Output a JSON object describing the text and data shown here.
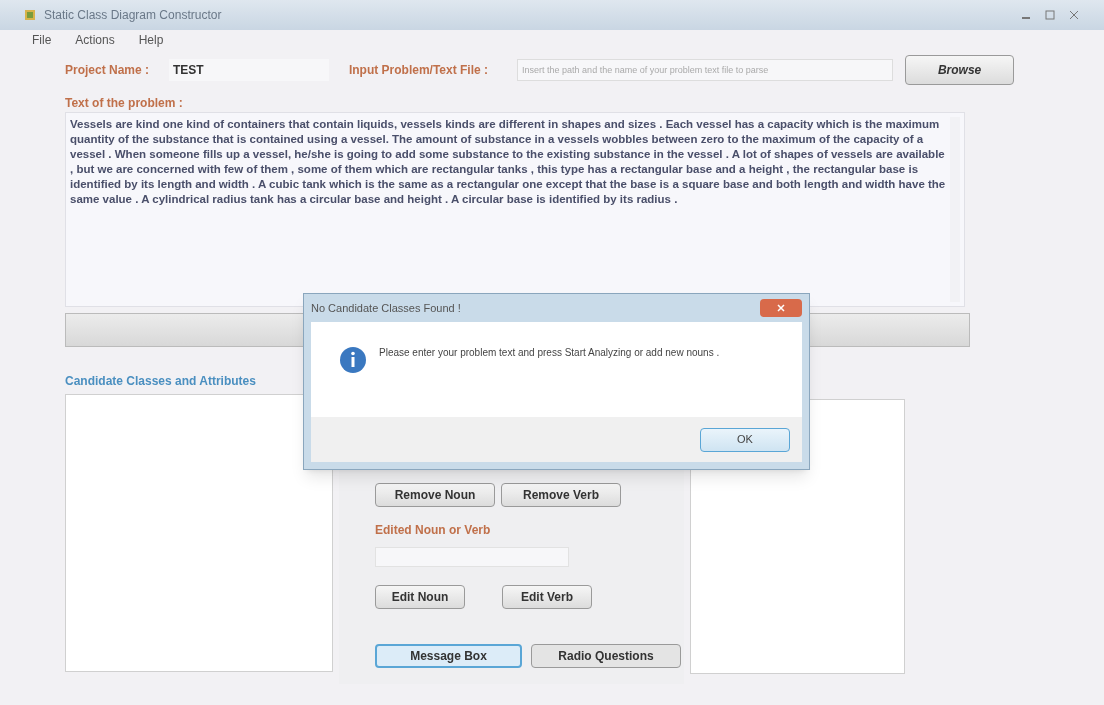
{
  "window": {
    "title": "Static Class Diagram Constructor"
  },
  "menu": [
    "File",
    "Actions",
    "Help"
  ],
  "project_name": {
    "label": "Project Name :",
    "value": "TEST"
  },
  "input_file": {
    "label": "Input Problem/Text File :",
    "placeholder": "Insert the path and the name of your problem text file to parse"
  },
  "browse_button": "Browse",
  "problem": {
    "label": "Text of the problem :",
    "value": "Vessels are kind one kind of containers that contain liquids, vessels kinds are different in shapes and sizes . Each vessel has a capacity which is the maximum quantity of the substance that is contained using a vessel. The amount of substance in a vessels wobbles between zero to the maximum of the capacity of a vessel . When someone fills up a vessel, he/she is going to add some substance to the existing substance in the vessel . A lot of shapes of vessels are available , but we are concerned with few of them , some of them which are rectangular tanks , this type has a rectangular base and a height , the rectangular base is identified by its length and width . A cubic tank which is the same as a rectangular one except that the base is a square base and both length and width have the same value . A cylindrical radius tank has a circular base and height . A circular base is identified by its radius ."
  },
  "candidates_label": "Candidate Classes and Attributes",
  "middle_panel": {
    "remove_buttons": [
      "Remove Noun",
      "Remove Verb"
    ],
    "edit_label": "Edited Noun or Verb",
    "edit_buttons": [
      "Edit Noun",
      "Edit Verb"
    ],
    "bottom_buttons": [
      {
        "label": "Message Box",
        "selected": true
      },
      {
        "label": "Radio Questions",
        "selected": false
      }
    ]
  },
  "dialog": {
    "title": "No Candidate Classes Found !",
    "message": "Please enter your problem text and press Start Analyzing or add new nouns .",
    "button": "OK"
  }
}
